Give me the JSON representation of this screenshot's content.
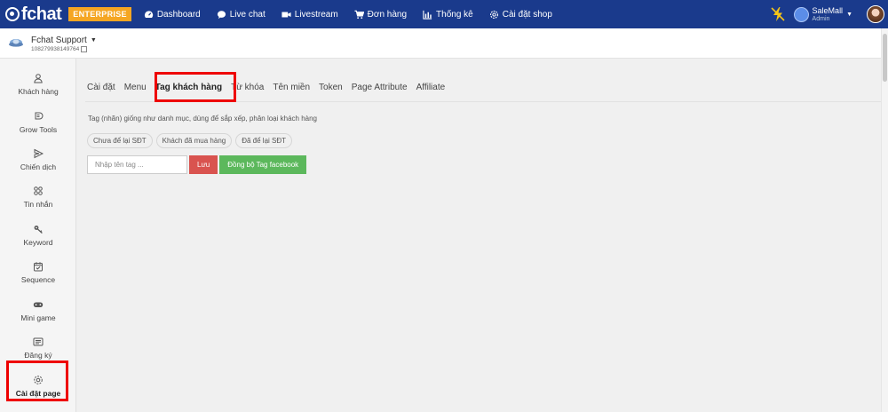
{
  "topbar": {
    "logo_text": "fchat",
    "plan_badge": "ENTERPRISE",
    "nav": [
      {
        "label": "Dashboard",
        "icon": "dashboard-icon"
      },
      {
        "label": "Live chat",
        "icon": "chat-bubble-icon"
      },
      {
        "label": "Livestream",
        "icon": "video-camera-icon"
      },
      {
        "label": "Đơn hàng",
        "icon": "cart-icon"
      },
      {
        "label": "Thống kê",
        "icon": "bar-chart-icon"
      },
      {
        "label": "Cài đặt shop",
        "icon": "gear-icon"
      }
    ],
    "user": {
      "name": "SaleMall",
      "role": "Admin"
    }
  },
  "page": {
    "name": "Fchat Support",
    "id": "108279938149764"
  },
  "sidebar": {
    "items": [
      {
        "label": "Khách hàng",
        "icon": "user-icon"
      },
      {
        "label": "Grow Tools",
        "icon": "grow-tools-icon"
      },
      {
        "label": "Chiến dịch",
        "icon": "send-icon"
      },
      {
        "label": "Tin nhắn",
        "icon": "message-grid-icon"
      },
      {
        "label": "Keyword",
        "icon": "key-icon"
      },
      {
        "label": "Sequence",
        "icon": "calendar-check-icon"
      },
      {
        "label": "Mini game",
        "icon": "gamepad-icon"
      },
      {
        "label": "Đăng ký",
        "icon": "list-icon"
      },
      {
        "label": "Cài đặt page",
        "icon": "gear-icon",
        "active": true
      }
    ]
  },
  "tabs": [
    {
      "label": "Cài đặt"
    },
    {
      "label": "Menu"
    },
    {
      "label": "Tag khách hàng",
      "active": true
    },
    {
      "label": "Từ khóa"
    },
    {
      "label": "Tên miền"
    },
    {
      "label": "Token"
    },
    {
      "label": "Page Attribute"
    },
    {
      "label": "Affiliate"
    }
  ],
  "tag_section": {
    "description": "Tag (nhãn) giống như danh mục, dùng để sắp xếp, phân loại khách hàng",
    "tags": [
      "Chưa để lại SĐT",
      "Khách đã mua hàng",
      "Đã để lại SĐT"
    ],
    "input_placeholder": "Nhập tên tag ...",
    "input_value": "",
    "save_label": "Lưu",
    "sync_label": "Đồng bộ Tag facebook"
  },
  "colors": {
    "topbar": "#1a3a8c",
    "badge": "#f5a623",
    "save_button": "#d9534f",
    "sync_button": "#5cb85c",
    "highlight": "#ee0000"
  }
}
